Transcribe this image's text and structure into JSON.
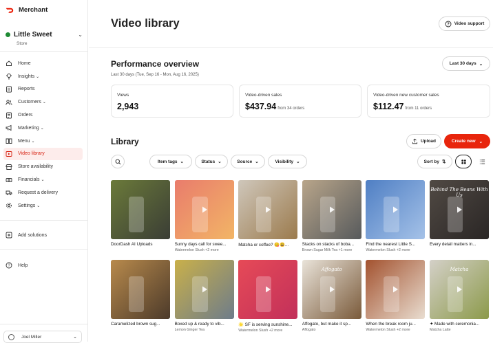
{
  "app": {
    "brand": "Merchant"
  },
  "store": {
    "name": "Little Sweet",
    "subtitle": "Store"
  },
  "nav": [
    {
      "label": "Home",
      "icon": "home-icon",
      "chev": false
    },
    {
      "label": "Insights",
      "icon": "lightbulb-icon",
      "chev": true
    },
    {
      "label": "Reports",
      "icon": "report-icon",
      "chev": false
    },
    {
      "label": "Customers",
      "icon": "customers-icon",
      "chev": true
    },
    {
      "label": "Orders",
      "icon": "orders-icon",
      "chev": false
    },
    {
      "label": "Marketing",
      "icon": "megaphone-icon",
      "chev": true
    },
    {
      "label": "Menu",
      "icon": "menu-book-icon",
      "chev": true
    },
    {
      "label": "Video library",
      "icon": "video-icon",
      "chev": false,
      "active": true
    },
    {
      "label": "Store availability",
      "icon": "store-icon",
      "chev": false
    },
    {
      "label": "Financials",
      "icon": "financials-icon",
      "chev": true
    },
    {
      "label": "Request a delivery",
      "icon": "delivery-icon",
      "chev": false
    },
    {
      "label": "Settings",
      "icon": "gear-icon",
      "chev": true
    }
  ],
  "nav_extra": {
    "add_solutions": "Add solutions",
    "help": "Help"
  },
  "user": {
    "name": "Joel Miller"
  },
  "page": {
    "title": "Video library",
    "support": "Video support"
  },
  "performance": {
    "title": "Performance overview",
    "range": "Last 30 days (Tue, Sep 16 - Mon, Aug 16, 2025)",
    "range_button": "Last 30 days",
    "stats": [
      {
        "label": "Views",
        "value": "2,943",
        "suffix": ""
      },
      {
        "label": "Video-driven sales",
        "value": "$437.94",
        "suffix": "from 34 orders"
      },
      {
        "label": "Video-driven new customer sales",
        "value": "$112.47",
        "suffix": "from 11 orders"
      }
    ]
  },
  "library": {
    "title": "Library",
    "upload": "Upload",
    "create": "Create new",
    "filters": [
      "Item tags",
      "Status",
      "Source",
      "Visibility"
    ],
    "sort": "Sort by"
  },
  "videos": [
    {
      "title": "DoorDash AI Uploads",
      "tag": "",
      "c1": "#6b7a3a",
      "c2": "#3a3d35",
      "play": false
    },
    {
      "title": "Sunny days call for swee...",
      "tag": "Watermelon Slush +2 more",
      "c1": "#e97c6c",
      "c2": "#f2b566",
      "play": true
    },
    {
      "title": "Matcha or coffee? 😋😃...",
      "tag": "",
      "c1": "#cfc7bb",
      "c2": "#9b7a4c",
      "play": true
    },
    {
      "title": "Stacks on stacks of boba...",
      "tag": "Brown Sugar Milk Tea +1 more",
      "c1": "#b8a58a",
      "c2": "#575a5c",
      "play": true
    },
    {
      "title": "Find the nearest Little S...",
      "tag": "Watermelon Slush +2 more",
      "c1": "#4f7fc4",
      "c2": "#a5c2e8",
      "play": true
    },
    {
      "title": "Every detail matters in...",
      "tag": "",
      "c1": "#514a44",
      "c2": "#2a2625",
      "play": true,
      "overlay": "Behind The Beans With Us"
    },
    {
      "title": "Caramelized brown sug...",
      "tag": "",
      "c1": "#b88a4c",
      "c2": "#4c3a2a",
      "play": false
    },
    {
      "title": "Boxed up & ready to vib...",
      "tag": "Lemon Ginger Tea",
      "c1": "#c9b04a",
      "c2": "#6e7c8a",
      "play": true
    },
    {
      "title": "🌟 SF is serving sunshine...",
      "tag": "Watermelon Slush +2 more",
      "c1": "#e64a57",
      "c2": "#c2305a",
      "play": true
    },
    {
      "title": "Affogato, but make it sp...",
      "tag": "Affogato",
      "c1": "#e9e3d9",
      "c2": "#7a5a3a",
      "play": true,
      "overlay": "Affogato"
    },
    {
      "title": "When the break room ju...",
      "tag": "Watermelon Slush +2 more",
      "c1": "#a3522f",
      "c2": "#e9ddd0",
      "play": true
    },
    {
      "title": "✦ Made with ceremonia...",
      "tag": "Matcha Latte",
      "c1": "#d4d0c8",
      "c2": "#8c9a4a",
      "play": true,
      "overlay": "Matcha"
    }
  ]
}
